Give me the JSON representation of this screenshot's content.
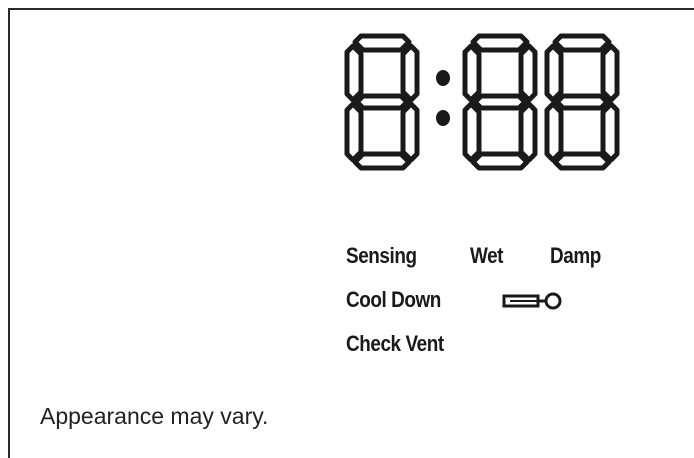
{
  "display": {
    "digits": [
      "8",
      "88"
    ],
    "separator": ":"
  },
  "indicators": {
    "sensing": "Sensing",
    "wet": "Wet",
    "damp": "Damp",
    "cool_down": "Cool Down",
    "check_vent": "Check Vent"
  },
  "icons": {
    "lock": "key-icon"
  },
  "note": "Appearance may vary.",
  "colors": {
    "segment": "#1a1a1a",
    "background": "#ffffff"
  }
}
